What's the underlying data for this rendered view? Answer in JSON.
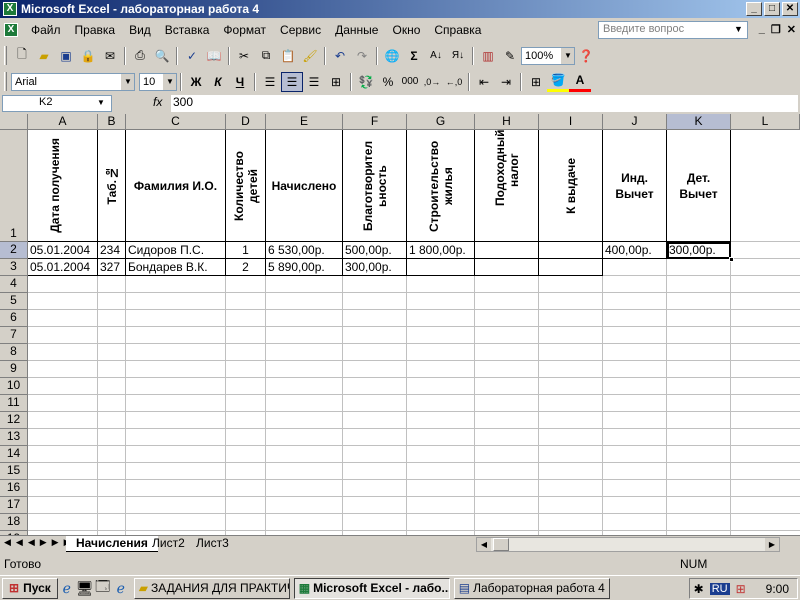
{
  "window": {
    "title": "Microsoft Excel - лабораторная работа 4",
    "app_icon": "X",
    "btn_min": "_",
    "btn_max": "□",
    "btn_close": "✕"
  },
  "menu": {
    "items": [
      "Файл",
      "Правка",
      "Вид",
      "Вставка",
      "Формат",
      "Сервис",
      "Данные",
      "Окно",
      "Справка"
    ],
    "help_placeholder": "Введите вопрос"
  },
  "toolbar": {
    "zoom": "100%",
    "font": "Arial",
    "size": "10",
    "bold": "Ж",
    "italic": "К",
    "underline": "Ч",
    "percent": "%",
    "thousands": "000",
    "sum": "Σ"
  },
  "formula": {
    "cell_ref": "K2",
    "fx": "fx",
    "value": "300"
  },
  "columns": [
    "A",
    "B",
    "C",
    "D",
    "E",
    "F",
    "G",
    "H",
    "I",
    "J",
    "K",
    "L"
  ],
  "rows": [
    "1",
    "2",
    "3",
    "4",
    "5",
    "6",
    "7",
    "8",
    "9",
    "10",
    "11",
    "12",
    "13",
    "14",
    "15",
    "16",
    "17",
    "18",
    "19"
  ],
  "headers": {
    "a": "Дата получения",
    "b": "Таб.№",
    "c": "Фамилия И.О.",
    "d": "Количество детей",
    "e": "Начислено",
    "f": "Благотворительность",
    "g": "Строительство жилья",
    "h": "Подоходный налог",
    "i": "К выдаче",
    "j": "Инд. Вычет",
    "k": "Дет. Вычет"
  },
  "data": [
    {
      "date": "05.01.2004",
      "tab": "234",
      "name": "Сидоров П.С.",
      "kids": "1",
      "accrued": "6 530,00р.",
      "charity": "500,00р.",
      "housing": "1 800,00р.",
      "tax": "",
      "payout": "",
      "ind": "400,00р.",
      "child": "300,00р."
    },
    {
      "date": "05.01.2004",
      "tab": "327",
      "name": "Бондарев В.К.",
      "kids": "2",
      "accrued": "5 890,00р.",
      "charity": "300,00р.",
      "housing": "",
      "tax": "",
      "payout": "",
      "ind": "",
      "child": ""
    }
  ],
  "sheets": [
    "Начисления",
    "Лист2",
    "Лист3"
  ],
  "status": {
    "ready": "Готово",
    "num": "NUM"
  },
  "taskbar": {
    "start": "Пуск",
    "tasks": [
      "ЗАДАНИЯ ДЛЯ ПРАКТИЧ...",
      "Microsoft Excel - лабо...",
      "Лабораторная работа 4 ..."
    ],
    "lang": "RU",
    "clock": "9:00"
  }
}
